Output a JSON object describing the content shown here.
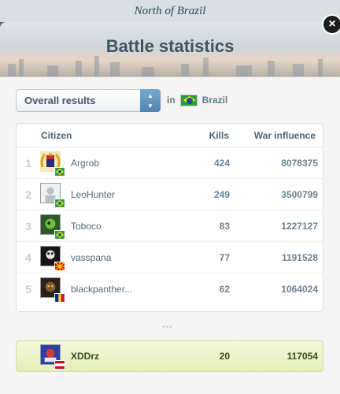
{
  "backdrop": {
    "region_title": "North of Brazil"
  },
  "modal": {
    "title": "Battle statistics",
    "close_label": "×"
  },
  "filter": {
    "selected": "Overall results",
    "in_label": "in",
    "country": "Brazil",
    "country_flag": "brazil-flag-icon"
  },
  "table": {
    "headers": {
      "citizen": "Citizen",
      "kills": "Kills",
      "war_influence": "War influence"
    },
    "rows": [
      {
        "rank": "1",
        "name": "Argrob",
        "kills": "424",
        "war_influence": "8078375",
        "flag": "brazil-flag-icon"
      },
      {
        "rank": "2",
        "name": "LeoHunter",
        "kills": "249",
        "war_influence": "3500799",
        "flag": "brazil-flag-icon"
      },
      {
        "rank": "3",
        "name": "Toboco",
        "kills": "83",
        "war_influence": "1227127",
        "flag": "brazil-flag-icon"
      },
      {
        "rank": "4",
        "name": "vasspana",
        "kills": "77",
        "war_influence": "1191528",
        "flag": "north-macedonia-flag-icon"
      },
      {
        "rank": "5",
        "name": "blackpanther...",
        "kills": "62",
        "war_influence": "1064024",
        "flag": "romania-flag-icon"
      }
    ],
    "more_indicator": "•••"
  },
  "current_user": {
    "name": "XDDrz",
    "kills": "20",
    "war_influence": "117054",
    "flag": "unknown-flag-icon"
  },
  "colors": {
    "accent_blue": "#4f84b1",
    "highlight_row": "#e4efb6",
    "title_text": "#3f5564"
  }
}
